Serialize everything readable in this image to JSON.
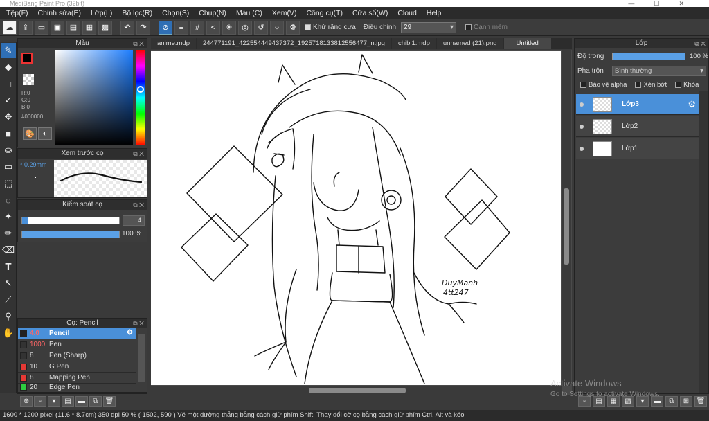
{
  "app": {
    "title": "MediBang Paint Pro (32bit)"
  },
  "menu": [
    "Tệp(F)",
    "Chỉnh sửa(E)",
    "Lớp(L)",
    "Bộ lọc(R)",
    "Chọn(S)",
    "Chụp(N)",
    "Màu (C)",
    "Xem(V)",
    "Công cụ(T)",
    "Cửa sổ(W)",
    "Cloud",
    "Help"
  ],
  "toolbar": {
    "antialias_label": "Khử răng cưa",
    "adjust_label": "Điều chỉnh",
    "adjust_value": "29",
    "lock_label": "Cạnh mềm"
  },
  "color_panel": {
    "title": "Màu",
    "r": "R:0",
    "g": "G:0",
    "b": "B:0",
    "hex": "#000000",
    "fg": "#000000",
    "bg": "#3c53e0"
  },
  "brush_preview": {
    "title": "Xem trước cọ",
    "size": "* 0.29mm"
  },
  "brush_control": {
    "title": "Kiểm soát cọ",
    "size_value": "4",
    "opacity_value": "100 %"
  },
  "brush_list": {
    "title": "Cọ: Pencil",
    "items": [
      {
        "size": "4.0",
        "name": "Pencil",
        "color": "#222222"
      },
      {
        "size": "1000",
        "name": "Pen",
        "color": "#333333"
      },
      {
        "size": "8",
        "name": "Pen (Sharp)",
        "color": "#333333"
      },
      {
        "size": "10",
        "name": "G Pen",
        "color": "#e53935"
      },
      {
        "size": "8",
        "name": "Mapping Pen",
        "color": "#e53935"
      },
      {
        "size": "20",
        "name": "Edge Pen",
        "color": "#2ecc40"
      }
    ]
  },
  "tabs": [
    "anime.mdp",
    "244771191_422554449437372_1925718133812556477_n.jpg",
    "chibi1.mdp",
    "unnamed (21).png",
    "Untitled"
  ],
  "layer_panel": {
    "title": "Lớp",
    "opacity_label": "Độ trong",
    "opacity_value": "100 %",
    "blend_label": "Pha trộn",
    "blend_value": "Bình thường",
    "check_alpha": "Bảo vệ alpha",
    "check_clip": "Xén bớt",
    "check_lock": "Khóa",
    "layers": [
      {
        "name": "Lớp3"
      },
      {
        "name": "Lớp2"
      },
      {
        "name": "Lớp1"
      }
    ]
  },
  "canvas": {
    "signature_line1": "DuyManh",
    "signature_line2": "4tt247"
  },
  "watermark": {
    "line1": "Activate Windows",
    "line2": "Go to Settings to activate Windows."
  },
  "status": {
    "text": "1600 * 1200 pixel   (11.6 * 8.7cm)   350 dpi   50 %   ( 1502, 590 )   Vẽ một đường thẳng bằng cách giữ phím Shift, Thay đổi cỡ cọ bằng cách giữ phím Ctrl, Alt và kéo"
  }
}
